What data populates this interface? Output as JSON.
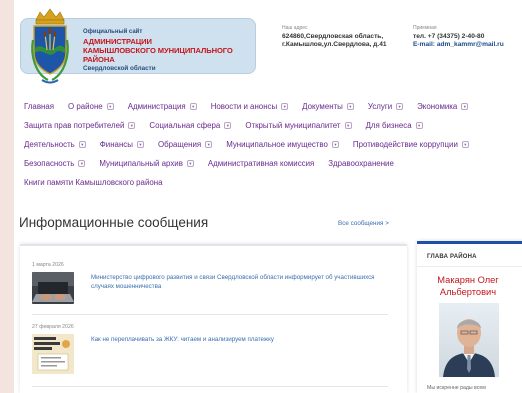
{
  "header": {
    "banner": {
      "line1": "Официальный сайт",
      "line2": "АДМИНИСТРАЦИИ",
      "line3": "КАМЫШЛОВСКОГО МУНИЦИПАЛЬНОГО РАЙОНА",
      "line4": "Свердловской области"
    },
    "address": {
      "label": "Наш адрес",
      "line1": "624860,Свердловская область,",
      "line2": "г.Камышлов,ул.Свердлова, д.41"
    },
    "reception": {
      "label": "Приемная",
      "phone": "тел. +7 (34375) 2-40-80",
      "email": "E-mail: adm_kammr@mail.ru"
    }
  },
  "nav": {
    "rows": [
      [
        {
          "label": "Главная",
          "caret": false
        },
        {
          "label": "О районе",
          "caret": true
        },
        {
          "label": "Администрация",
          "caret": true
        },
        {
          "label": "Новости и анонсы",
          "caret": true
        },
        {
          "label": "Документы",
          "caret": true
        },
        {
          "label": "Услуги",
          "caret": true
        },
        {
          "label": "Экономика",
          "caret": true
        }
      ],
      [
        {
          "label": "Защита прав потребителей",
          "caret": true
        },
        {
          "label": "Социальная сфера",
          "caret": true
        },
        {
          "label": "Открытый муниципалитет",
          "caret": true
        },
        {
          "label": "Для бизнеса",
          "caret": true
        }
      ],
      [
        {
          "label": "Деятельность",
          "caret": true
        },
        {
          "label": "Финансы",
          "caret": true
        },
        {
          "label": "Обращения",
          "caret": true
        },
        {
          "label": "Муниципальное имущество",
          "caret": true
        },
        {
          "label": "Противодействие коррупции",
          "caret": true
        }
      ],
      [
        {
          "label": "Безопасность",
          "caret": true
        },
        {
          "label": "Муниципальный архив",
          "caret": true
        },
        {
          "label": "Административная комиссия",
          "caret": false
        },
        {
          "label": "Здравоохранение",
          "caret": false
        }
      ],
      [
        {
          "label": "Книги памяти Камышловского района",
          "caret": false
        }
      ]
    ]
  },
  "main": {
    "title": "Информационные сообщения",
    "all_link": "Все сообщения >",
    "news": [
      {
        "date": "1 марта 2026",
        "title": "Министерство цифрового развития и связи Свердловской области информирует об участившихся случаях мошенничества",
        "thumb": "laptop-photo"
      },
      {
        "date": "27 февраля 2026",
        "title": "Как не переплачивать за ЖКУ: читаем и анализируем платежку",
        "thumb": "utility-bill-poster"
      }
    ]
  },
  "sidebar": {
    "heading": "ГЛАВА РАЙОНА",
    "name_line1": "Макарян Олег",
    "name_line2": "Альбертович",
    "text": "Мы искренне рады всем"
  },
  "colors": {
    "page_bg": "#f3e4df",
    "nav_link": "#6a2a8e",
    "accent_red": "#c4161c",
    "link_blue": "#3a6fb0",
    "sidebar_top": "#1f4fa8"
  }
}
